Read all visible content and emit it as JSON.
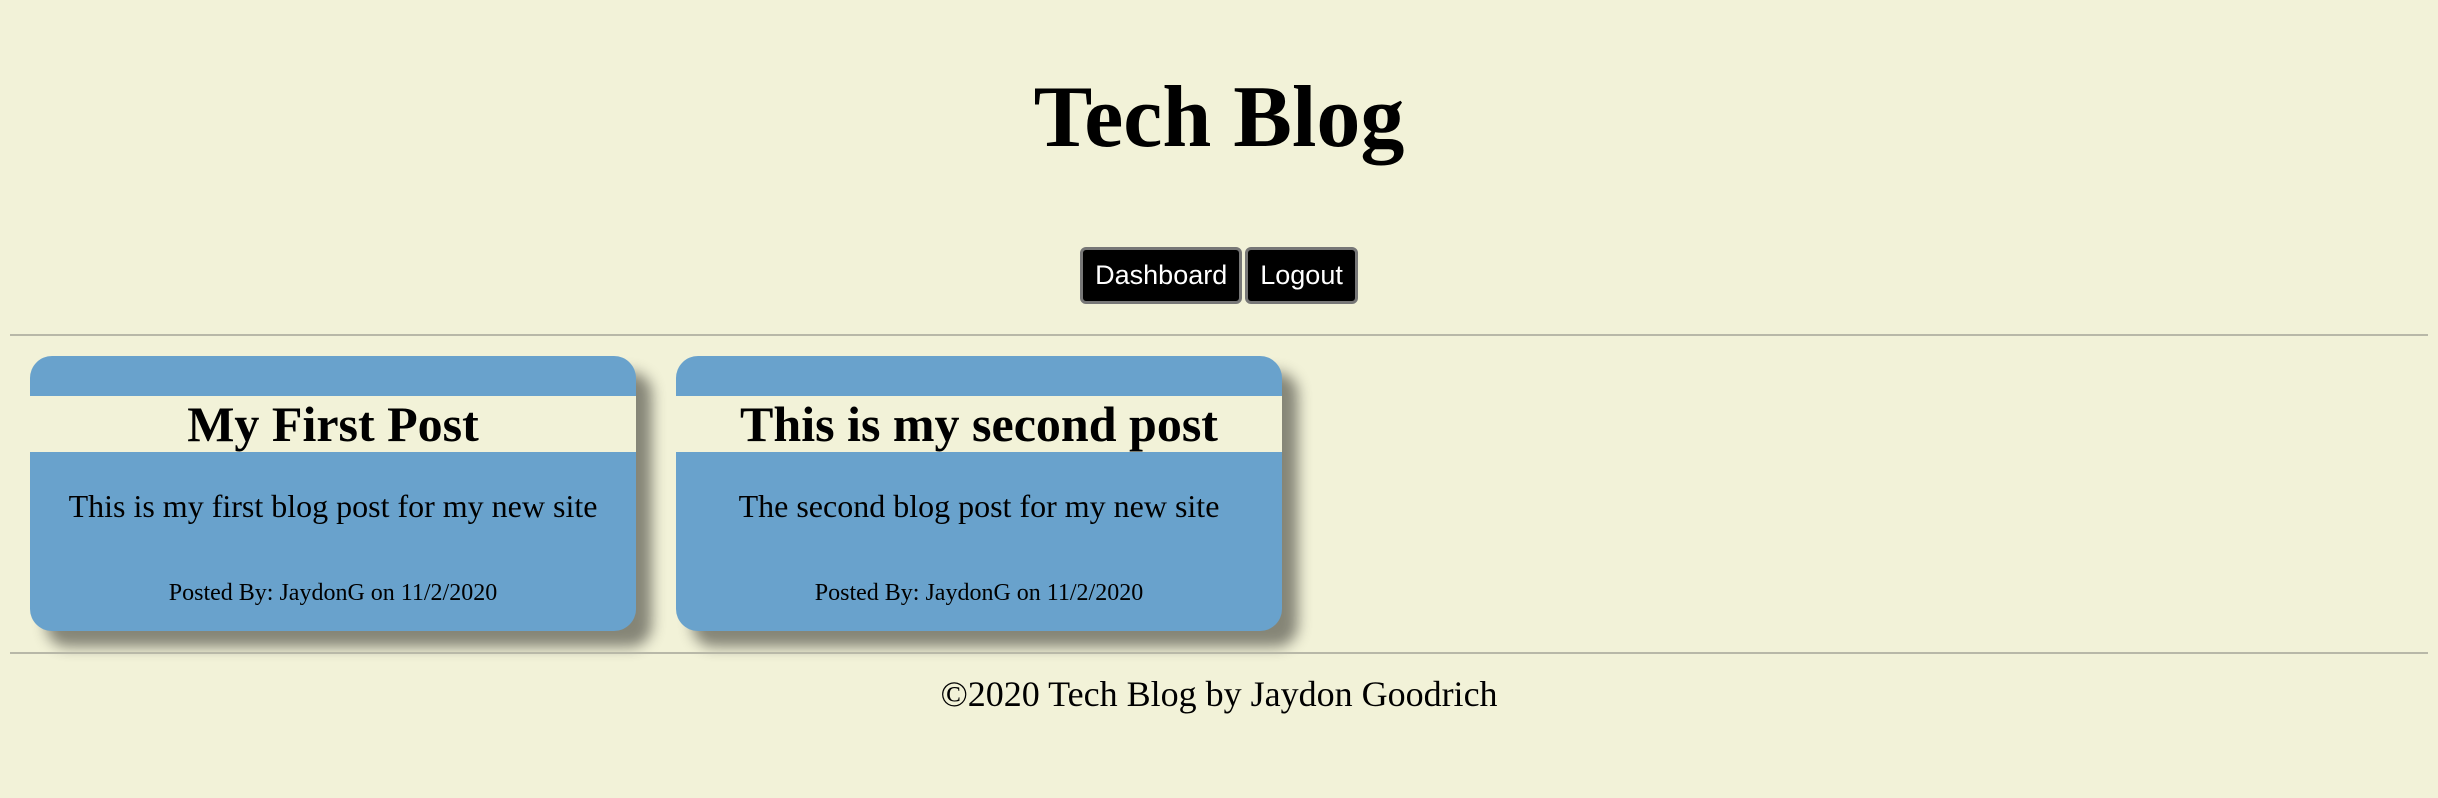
{
  "header": {
    "title": "Tech Blog"
  },
  "nav": {
    "dashboard_label": "Dashboard",
    "logout_label": "Logout"
  },
  "posts": [
    {
      "title": "My First Post",
      "body": "This is my first blog post for my new site",
      "meta": "Posted By: JaydonG on 11/2/2020"
    },
    {
      "title": "This is my second post",
      "body": "The second blog post for my new site",
      "meta": "Posted By: JaydonG on 11/2/2020"
    }
  ],
  "footer": {
    "text": "©2020 Tech Blog by Jaydon Goodrich"
  },
  "colors": {
    "page_background": "#f2f2d8",
    "card_background": "#69a2cc",
    "button_background": "#000000",
    "button_text": "#ffffff"
  }
}
